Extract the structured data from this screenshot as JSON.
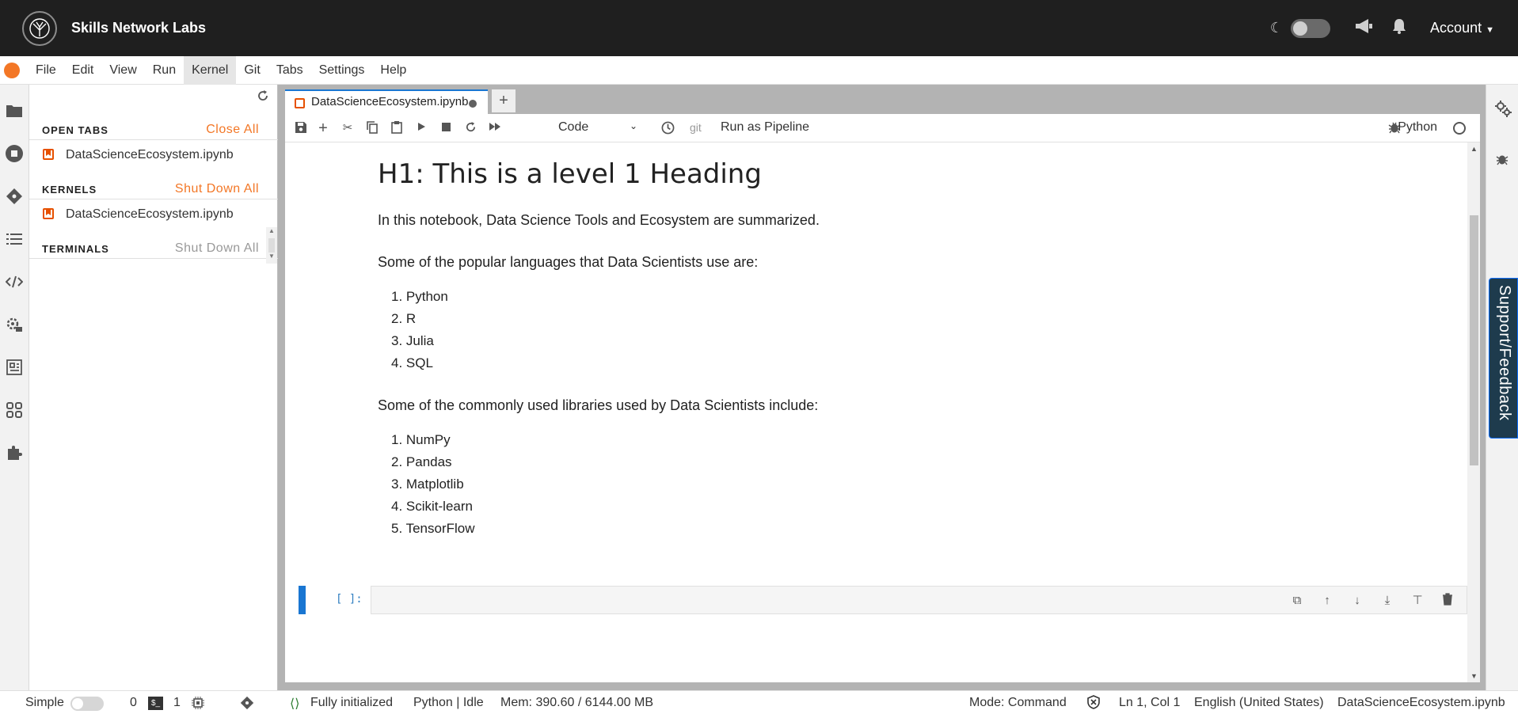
{
  "header": {
    "brand": "Skills Network Labs",
    "account": "Account"
  },
  "menu": [
    "File",
    "Edit",
    "View",
    "Run",
    "Kernel",
    "Git",
    "Tabs",
    "Settings",
    "Help"
  ],
  "panel": {
    "open_tabs": {
      "title": "OPEN TABS",
      "action": "Close All",
      "items": [
        "DataScienceEcosystem.ipynb"
      ]
    },
    "kernels": {
      "title": "KERNELS",
      "action": "Shut Down All",
      "items": [
        "DataScienceEcosystem.ipynb"
      ]
    },
    "terminals": {
      "title": "TERMINALS",
      "action": "Shut Down All"
    }
  },
  "doc_tab": {
    "label": "DataScienceEcosystem.ipynb"
  },
  "toolbar": {
    "cell_type": "Code",
    "git": "git",
    "pipeline": "Run as Pipeline",
    "kernel": "Python"
  },
  "notebook": {
    "heading": "H1: This is a level 1 Heading",
    "intro": "In this notebook, Data Science Tools and Ecosystem are summarized.",
    "languages_intro": "Some of the popular languages that Data Scientists use are:",
    "languages": [
      "1. Python",
      "2. R",
      "3. Julia",
      "4. SQL"
    ],
    "libraries_intro": "Some of the commonly used libraries used by Data Scientists include:",
    "libraries": [
      "1. NumPy",
      "2. Pandas",
      "3. Matplotlib",
      "4. Scikit-learn",
      "5. TensorFlow"
    ],
    "prompt": "[ ]:"
  },
  "support": "Support/Feedback",
  "status": {
    "mode_label": "Simple",
    "terminals_count": "0",
    "kernels_count": "1",
    "init": "Fully initialized",
    "kernel_state": "Python | Idle",
    "mem": "Mem: 390.60 / 6144.00 MB",
    "mode": "Mode: Command",
    "cursor": "Ln 1, Col 1",
    "lang": "English (United States)",
    "file": "DataScienceEcosystem.ipynb"
  },
  "colors": {
    "accent": "#f37726",
    "active_blue": "#1976d2",
    "header_bg": "#1f1f1f"
  }
}
